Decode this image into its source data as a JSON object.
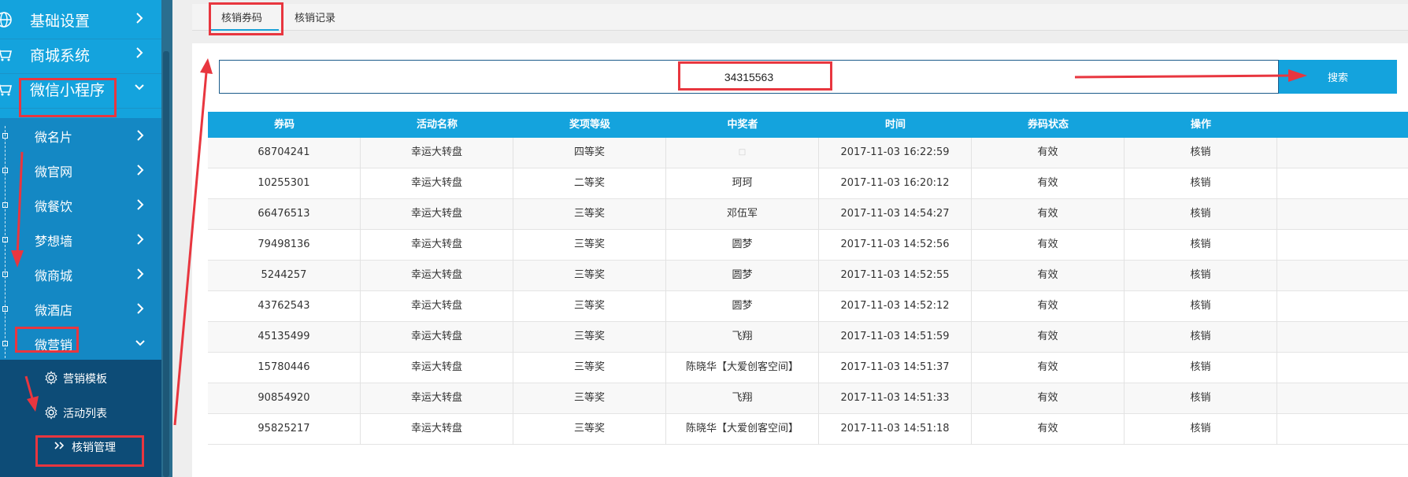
{
  "sidebar": {
    "top_items": [
      {
        "label": "基础设置",
        "icon": "globe-icon"
      },
      {
        "label": "商城系统",
        "icon": "cart-icon"
      },
      {
        "label": "微信小程序",
        "icon": "cart-icon"
      }
    ],
    "sub_items": [
      {
        "label": "微名片"
      },
      {
        "label": "微官网"
      },
      {
        "label": "微餐饮"
      },
      {
        "label": "梦想墙"
      },
      {
        "label": "微商城"
      },
      {
        "label": "微酒店"
      },
      {
        "label": "微营销"
      }
    ],
    "third_items": [
      {
        "label": "营销模板",
        "icon": "gear-icon"
      },
      {
        "label": "活动列表",
        "icon": "gear-icon"
      },
      {
        "label": "核销管理",
        "icon": "double-chevron-icon"
      }
    ]
  },
  "tabs": [
    {
      "label": "核销券码",
      "active": true
    },
    {
      "label": "核销记录",
      "active": false
    }
  ],
  "search": {
    "value": "34315563",
    "button_label": "搜索"
  },
  "table": {
    "columns": [
      "券码",
      "活动名称",
      "奖项等级",
      "中奖者",
      "时间",
      "券码状态",
      "操作"
    ],
    "rows": [
      [
        "68704241",
        "幸运大转盘",
        "四等奖",
        "□",
        "2017-11-03 16:22:59",
        "有效",
        "核销"
      ],
      [
        "10255301",
        "幸运大转盘",
        "二等奖",
        "珂珂",
        "2017-11-03 16:20:12",
        "有效",
        "核销"
      ],
      [
        "66476513",
        "幸运大转盘",
        "三等奖",
        "邓伍军",
        "2017-11-03 14:54:27",
        "有效",
        "核销"
      ],
      [
        "79498136",
        "幸运大转盘",
        "三等奖",
        "圆梦",
        "2017-11-03 14:52:56",
        "有效",
        "核销"
      ],
      [
        "5244257",
        "幸运大转盘",
        "三等奖",
        "圆梦",
        "2017-11-03 14:52:55",
        "有效",
        "核销"
      ],
      [
        "43762543",
        "幸运大转盘",
        "三等奖",
        "圆梦",
        "2017-11-03 14:52:12",
        "有效",
        "核销"
      ],
      [
        "45135499",
        "幸运大转盘",
        "三等奖",
        "飞翔",
        "2017-11-03 14:51:59",
        "有效",
        "核销"
      ],
      [
        "15780446",
        "幸运大转盘",
        "三等奖",
        "陈晓华【大爱创客空间】",
        "2017-11-03 14:51:37",
        "有效",
        "核销"
      ],
      [
        "90854920",
        "幸运大转盘",
        "三等奖",
        "飞翔",
        "2017-11-03 14:51:33",
        "有效",
        "核销"
      ],
      [
        "95825217",
        "幸运大转盘",
        "三等奖",
        "陈晓华【大爱创客空间】",
        "2017-11-03 14:51:18",
        "有效",
        "核销"
      ]
    ]
  },
  "colors": {
    "sidebar_blue": "#14a3dd",
    "sidebar_sub": "#1488c4",
    "sidebar_third": "#0d4c77",
    "header_blue": "#14a3dd",
    "annotation_red": "#e8363f"
  }
}
